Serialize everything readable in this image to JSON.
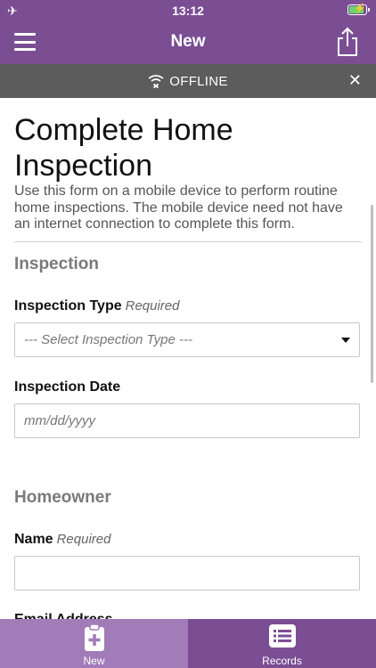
{
  "status_bar": {
    "time": "13:12"
  },
  "nav": {
    "title": "New"
  },
  "offline": {
    "label": "OFFLINE"
  },
  "form": {
    "title": "Complete Home Inspection",
    "description": "Use this form on a mobile device to perform routine home inspections. The mobile device need not have an internet connection to complete this form.",
    "sections": [
      {
        "title": "Inspection",
        "fields": [
          {
            "label": "Inspection Type",
            "required_label": "Required",
            "placeholder": "--- Select Inspection Type ---"
          },
          {
            "label": "Inspection Date",
            "required_label": "",
            "placeholder": "mm/dd/yyyy"
          }
        ]
      },
      {
        "title": "Homeowner",
        "fields": [
          {
            "label": "Name",
            "required_label": "Required",
            "placeholder": ""
          },
          {
            "label": "Email Address",
            "required_label": "",
            "placeholder": ""
          }
        ]
      }
    ]
  },
  "tabs": [
    {
      "label": "New",
      "icon": "clipboard-plus-icon",
      "active": true
    },
    {
      "label": "Records",
      "icon": "list-icon",
      "active": false
    }
  ],
  "colors": {
    "brand": "#7b4e94",
    "tab_active": "#a17cb8",
    "offline_bar": "#5c5c5c"
  }
}
